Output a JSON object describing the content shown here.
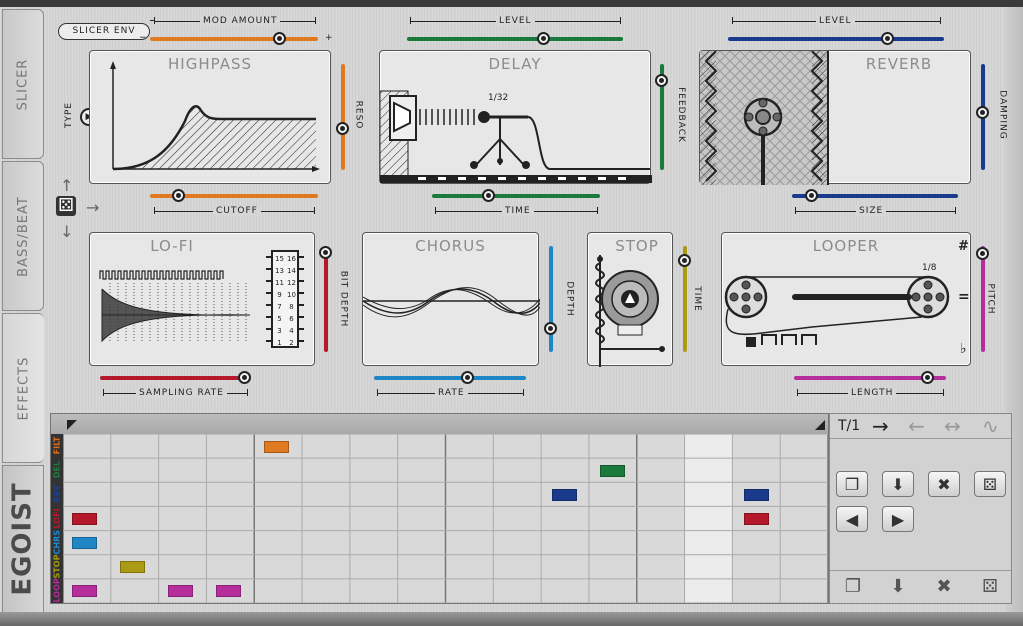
{
  "tabs": {
    "slicer": "SLICER",
    "bassbeat": "BASS/BEAT",
    "effects": "EFFECTS"
  },
  "logo": "EGOIST",
  "slicer_env": "SLICER ENV",
  "mod_amount": {
    "label": "MOD AMOUNT",
    "minus": "−",
    "plus": "+"
  },
  "type_label": "TYPE",
  "panels": {
    "highpass": {
      "title": "HIGHPASS",
      "reso": "RESO",
      "cutoff": "CUTOFF"
    },
    "delay": {
      "title": "DELAY",
      "level": "LEVEL",
      "feedback": "FEEDBACK",
      "time": "TIME",
      "division": "1/32"
    },
    "reverb": {
      "title": "REVERB",
      "level": "LEVEL",
      "damping": "DAMPING",
      "size": "SIZE"
    },
    "lofi": {
      "title": "LO-FI",
      "bitdepth": "BIT DEPTH",
      "sampling": "SAMPLING RATE",
      "chip_left": [
        "15",
        "13",
        "11",
        "9",
        "7",
        "5",
        "3",
        "1"
      ],
      "chip_right": [
        "16",
        "14",
        "12",
        "10",
        "8",
        "6",
        "4",
        "2"
      ]
    },
    "chorus": {
      "title": "CHORUS",
      "depth": "DEPTH",
      "rate": "RATE"
    },
    "stop": {
      "title": "STOP",
      "time": "TIME"
    },
    "looper": {
      "title": "LOOPER",
      "pitch": "PITCH",
      "length": "LENGTH",
      "division": "1/8",
      "sharp": "#",
      "flat": "♭",
      "equal": "="
    }
  },
  "seq_rows": [
    {
      "label": "FILT",
      "color": "#e06c1a"
    },
    {
      "label": "DEL",
      "color": "#1f7a3c"
    },
    {
      "label": "REV",
      "color": "#1d3f9a"
    },
    {
      "label": "LOFI",
      "color": "#b5182a"
    },
    {
      "label": "CHRS",
      "color": "#1f8ad0"
    },
    {
      "label": "STOP",
      "color": "#a69b12"
    },
    {
      "label": "LOOP",
      "color": "#b52b9a"
    }
  ],
  "ctrl": {
    "time": "T/1",
    "arrow_fwd": "→",
    "arrow_back": "←",
    "arrow_both": "↔",
    "arrow_wave": "∿",
    "prev": "◀",
    "next": "▶",
    "copy": "❐",
    "save": "⬇",
    "clear": "✖",
    "random": "⚄"
  },
  "nav": {
    "up": "↑",
    "right": "→",
    "down": "↓",
    "dice": "⚄"
  },
  "colors": {
    "orange": "#e07a20",
    "green": "#1a7a3c",
    "navy": "#1a3a8c",
    "red": "#b5182a",
    "blue": "#1f86c6",
    "olive": "#aa9a14",
    "magenta": "#b52e9c"
  }
}
